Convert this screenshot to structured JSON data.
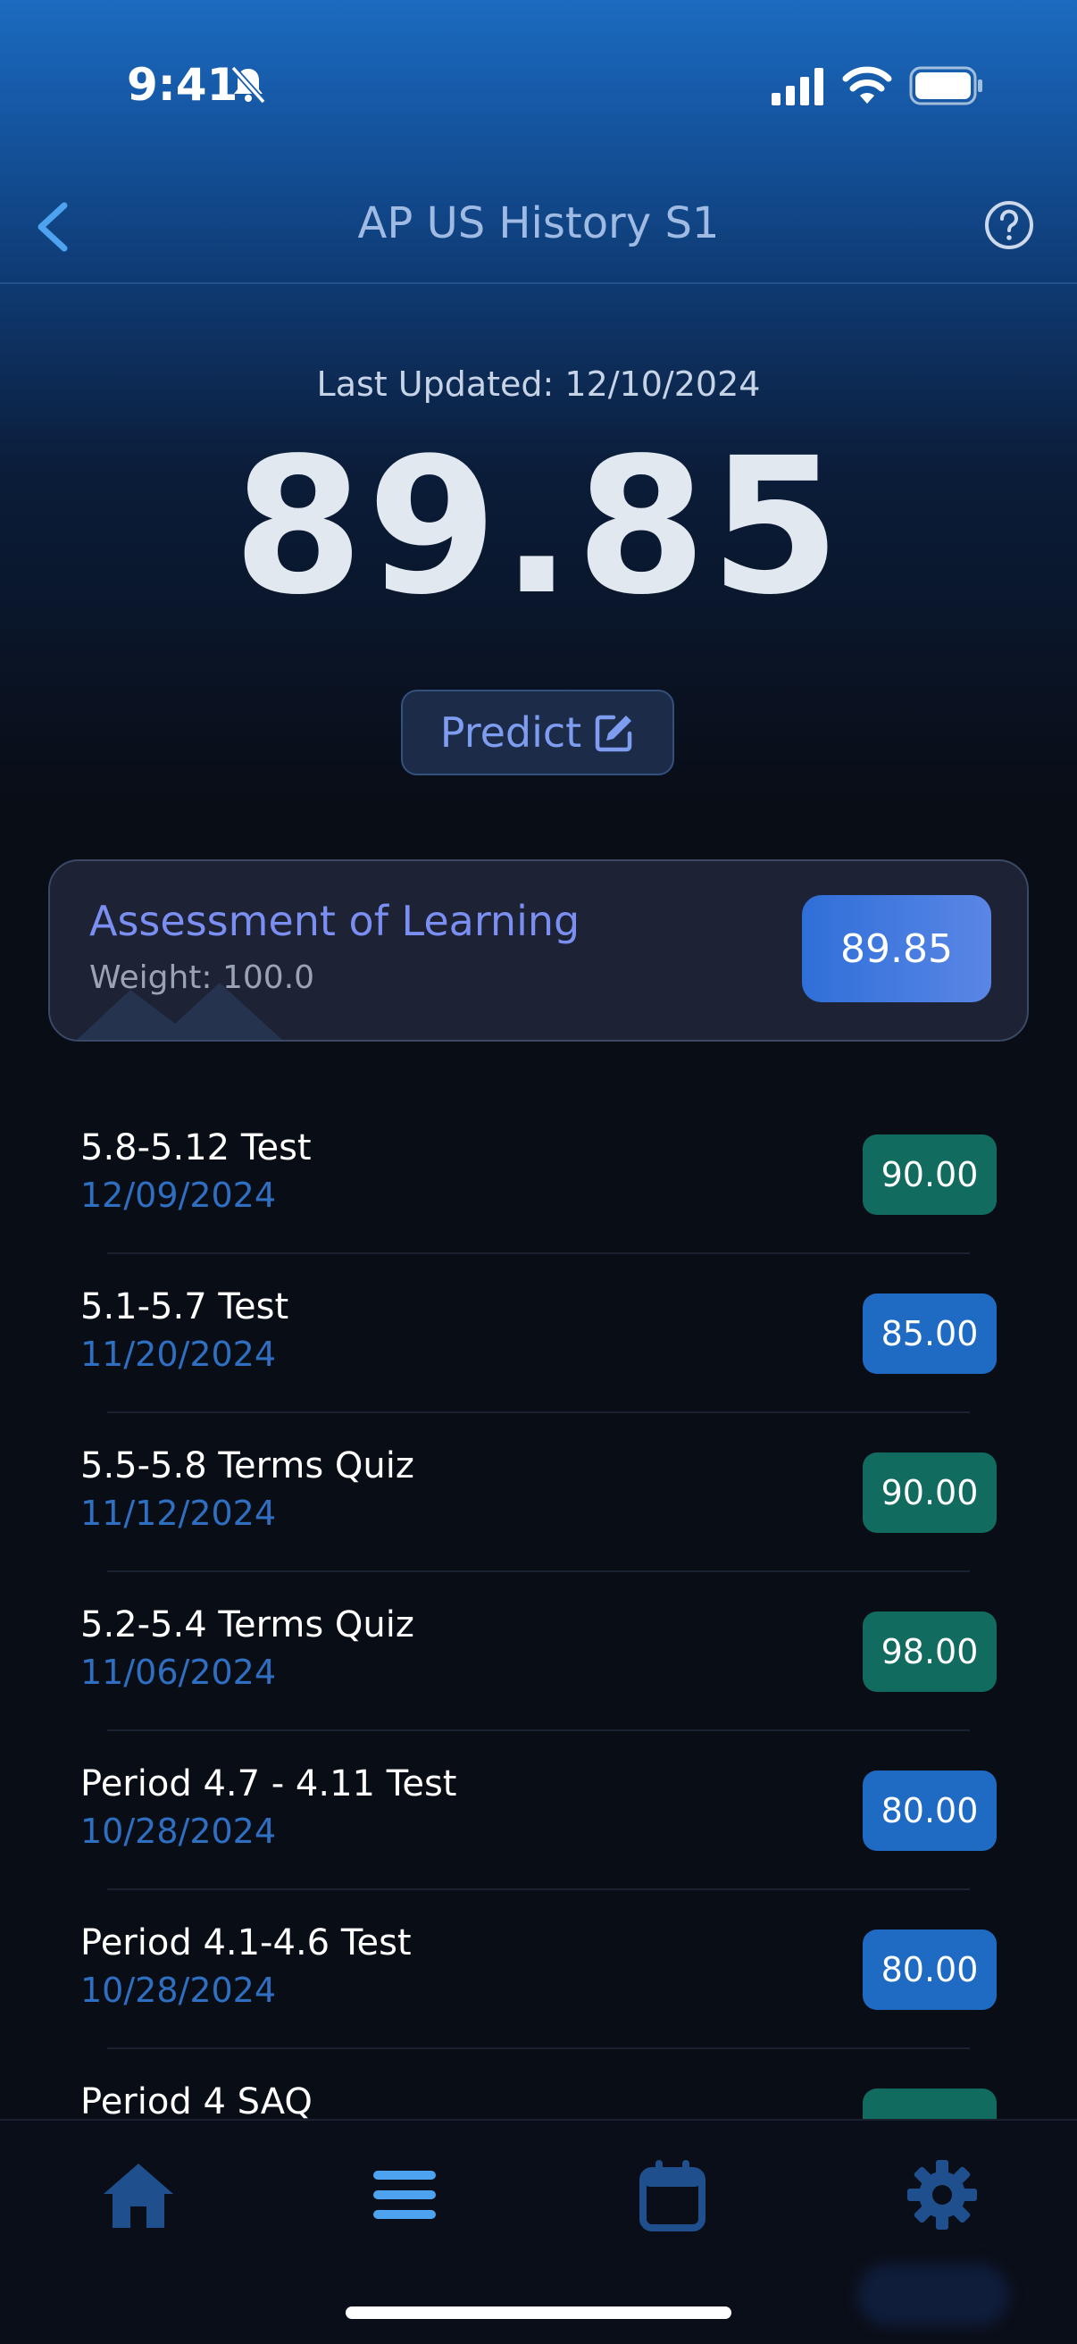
{
  "status_bar": {
    "time": "9:41"
  },
  "nav": {
    "title": "AP US History S1"
  },
  "header": {
    "last_updated": "Last Updated: 12/10/2024",
    "overall_grade": "89.85",
    "predict_label": "Predict"
  },
  "category": {
    "name": "Assessment of Learning",
    "weight": "Weight: 100.0",
    "score": "89.85"
  },
  "assignments": [
    {
      "name": "5.8-5.12 Test",
      "date": "12/09/2024",
      "score": "90.00",
      "color": "#116b5e"
    },
    {
      "name": "5.1-5.7 Test",
      "date": "11/20/2024",
      "score": "85.00",
      "color": "#1f6bc4"
    },
    {
      "name": "5.5-5.8 Terms Quiz",
      "date": "11/12/2024",
      "score": "90.00",
      "color": "#116b5e"
    },
    {
      "name": "5.2-5.4 Terms Quiz",
      "date": "11/06/2024",
      "score": "98.00",
      "color": "#116b5e"
    },
    {
      "name": "Period 4.7 - 4.11 Test",
      "date": "10/28/2024",
      "score": "80.00",
      "color": "#1f6bc4"
    },
    {
      "name": "Period 4.1-4.6 Test",
      "date": "10/28/2024",
      "score": "80.00",
      "color": "#1f6bc4"
    },
    {
      "name": "Period 4 SAQ",
      "date": "",
      "score": "",
      "color": "#116b5e"
    }
  ],
  "tab_bar": {
    "tabs": [
      {
        "icon": "home-icon",
        "active": false
      },
      {
        "icon": "list-icon",
        "active": true
      },
      {
        "icon": "calendar-icon",
        "active": false
      },
      {
        "icon": "gear-icon",
        "active": false
      }
    ]
  },
  "colors": {
    "accent": "#4da3f0",
    "inactive_tab": "#1f4f8c",
    "green_badge": "#116b5e",
    "blue_badge": "#1f6bc4"
  }
}
